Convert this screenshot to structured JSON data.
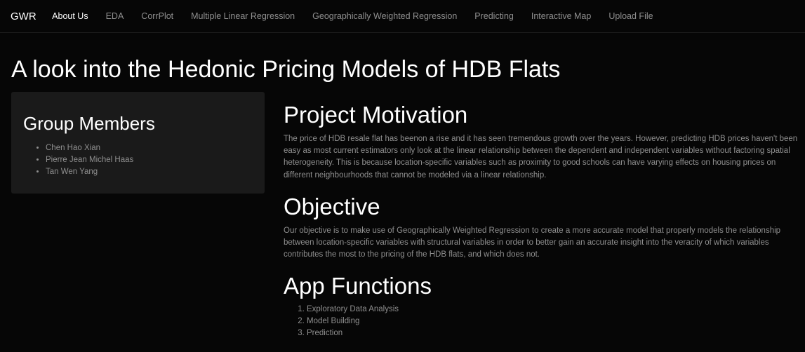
{
  "navbar": {
    "brand": "GWR",
    "items": [
      {
        "label": "About Us",
        "active": true
      },
      {
        "label": "EDA",
        "active": false
      },
      {
        "label": "CorrPlot",
        "active": false
      },
      {
        "label": "Multiple Linear Regression",
        "active": false
      },
      {
        "label": "Geographically Weighted Regression",
        "active": false
      },
      {
        "label": "Predicting",
        "active": false
      },
      {
        "label": "Interactive Map",
        "active": false
      },
      {
        "label": "Upload File",
        "active": false
      }
    ]
  },
  "page": {
    "title": "A look into the Hedonic Pricing Models of HDB Flats"
  },
  "sidebar": {
    "title": "Group Members",
    "members": [
      "Chen Hao Xian",
      "Pierre Jean Michel Haas",
      "Tan Wen Yang"
    ]
  },
  "main": {
    "motivation": {
      "title": "Project Motivation",
      "text": "The price of HDB resale flat has beenon a rise and it has seen tremendous growth over the years. However, predicting HDB prices haven't been easy as most current estimators only look at the linear relationship between the dependent and independent variables without factoring spatial heterogeneity. This is because location-specific variables such as proximity to good schools can have varying effects on housing prices on different neighbourhoods that cannot be modeled via a linear relationship."
    },
    "objective": {
      "title": "Objective",
      "text": "Our objective is to make use of Geographically Weighted Regression to create a more accurate model that properly models the relationship between location-specific variables with structural variables in order to better gain an accurate insight into the veracity of which variables contributes the most to the pricing of the HDB flats, and which does not."
    },
    "functions": {
      "title": "App Functions",
      "items": [
        "Exploratory Data Analysis",
        "Model Building",
        "Prediction"
      ]
    }
  },
  "colors": {
    "background": "#060606",
    "panel": "#1a1a1a",
    "text_muted": "#8f8f8f",
    "text_bright": "#ffffff"
  }
}
